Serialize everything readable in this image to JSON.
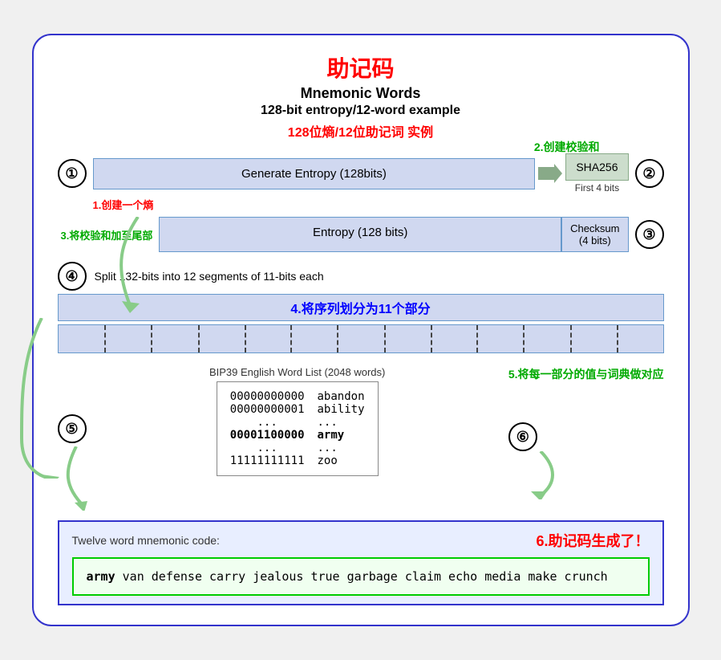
{
  "title": {
    "zh": "助记码",
    "en1": "Mnemonic Words",
    "en2": "128-bit entropy/12-word example",
    "zh2_red": "128位熵/12位助记词 实例"
  },
  "labels": {
    "step2_zh": "2.创建校验和",
    "step1_zh": "1.创建一个熵",
    "step3_zh": "3.将校验和加至尾部",
    "step4_zh": "4.将序列划分为11个部分",
    "step5_zh": "5.将每一部分的值与词典做对应",
    "step6_zh": "6.助记码生成了！"
  },
  "step1": {
    "circle": "①",
    "box_text": "Generate Entropy (128bits)",
    "sha_label": "SHA256",
    "first4": "First 4 bits"
  },
  "step3": {
    "add_label": "3.将校验和加至尾部",
    "entropy_label": "Entropy (128 bits)",
    "checksum_label": "Checksum",
    "checksum_bits": "(4 bits)",
    "circle": "③"
  },
  "step4": {
    "circle": "④",
    "description": "Split 132-bits into 12 segments of 11-bits each",
    "zh_label": "4.将序列划分为11个部分",
    "segment_count": 13
  },
  "step5": {
    "circle": "⑤",
    "bip39_label": "BIP39 English Word List (2048 words)",
    "rows": [
      {
        "bits": "00000000000",
        "word": "abandon"
      },
      {
        "bits": "00000000001",
        "word": "ability"
      },
      {
        "bits": "...",
        "word": "..."
      },
      {
        "bits": "00001100000",
        "word": "army",
        "highlight": true
      },
      {
        "bits": "...",
        "word": "..."
      },
      {
        "bits": "11111111111",
        "word": "zoo"
      }
    ]
  },
  "step6": {
    "circle": "⑥",
    "twelve_word_label": "Twelve word mnemonic code:",
    "zh_label": "6.助记码生成了！",
    "mnemonic_word1_bold": "army",
    "mnemonic_rest": " van defense carry jealous true garbage claim echo media make crunch"
  },
  "colors": {
    "red": "#ff0000",
    "green": "#00aa00",
    "blue": "#0000ff",
    "dark_blue": "#3333cc",
    "box_bg": "#d0d8f0",
    "box_border": "#6699cc",
    "sha_bg": "#ccddcc",
    "mnemonic_border": "#00cc00",
    "mnemonic_bg": "#f0fff0"
  }
}
